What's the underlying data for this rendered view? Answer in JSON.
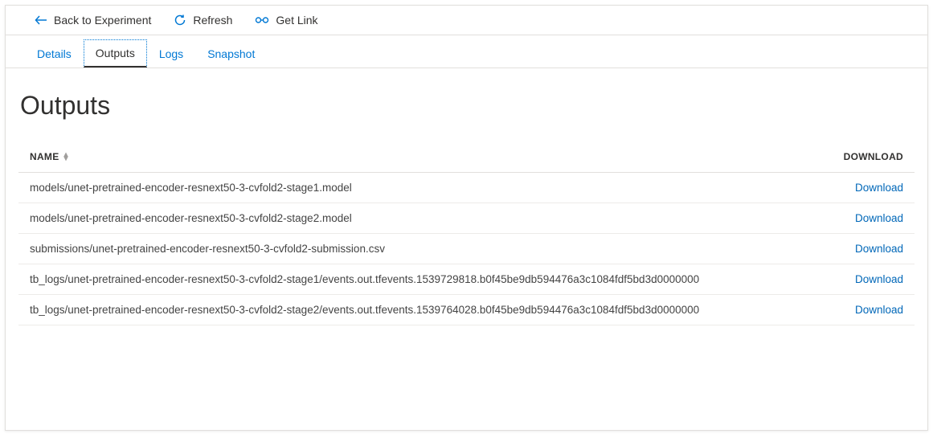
{
  "toolbar": {
    "back_label": "Back to Experiment",
    "refresh_label": "Refresh",
    "getlink_label": "Get Link"
  },
  "tabs": [
    {
      "label": "Details",
      "active": false
    },
    {
      "label": "Outputs",
      "active": true
    },
    {
      "label": "Logs",
      "active": false
    },
    {
      "label": "Snapshot",
      "active": false
    }
  ],
  "page_title": "Outputs",
  "table": {
    "headers": {
      "name": "NAME",
      "download": "DOWNLOAD"
    },
    "download_label": "Download",
    "rows": [
      {
        "name": "models/unet-pretrained-encoder-resnext50-3-cvfold2-stage1.model"
      },
      {
        "name": "models/unet-pretrained-encoder-resnext50-3-cvfold2-stage2.model"
      },
      {
        "name": "submissions/unet-pretrained-encoder-resnext50-3-cvfold2-submission.csv"
      },
      {
        "name": "tb_logs/unet-pretrained-encoder-resnext50-3-cvfold2-stage1/events.out.tfevents.1539729818.b0f45be9db594476a3c1084fdf5bd3d0000000"
      },
      {
        "name": "tb_logs/unet-pretrained-encoder-resnext50-3-cvfold2-stage2/events.out.tfevents.1539764028.b0f45be9db594476a3c1084fdf5bd3d0000000"
      }
    ]
  },
  "colors": {
    "link": "#0078d4",
    "text": "#323130",
    "border": "#e1dfdd"
  }
}
